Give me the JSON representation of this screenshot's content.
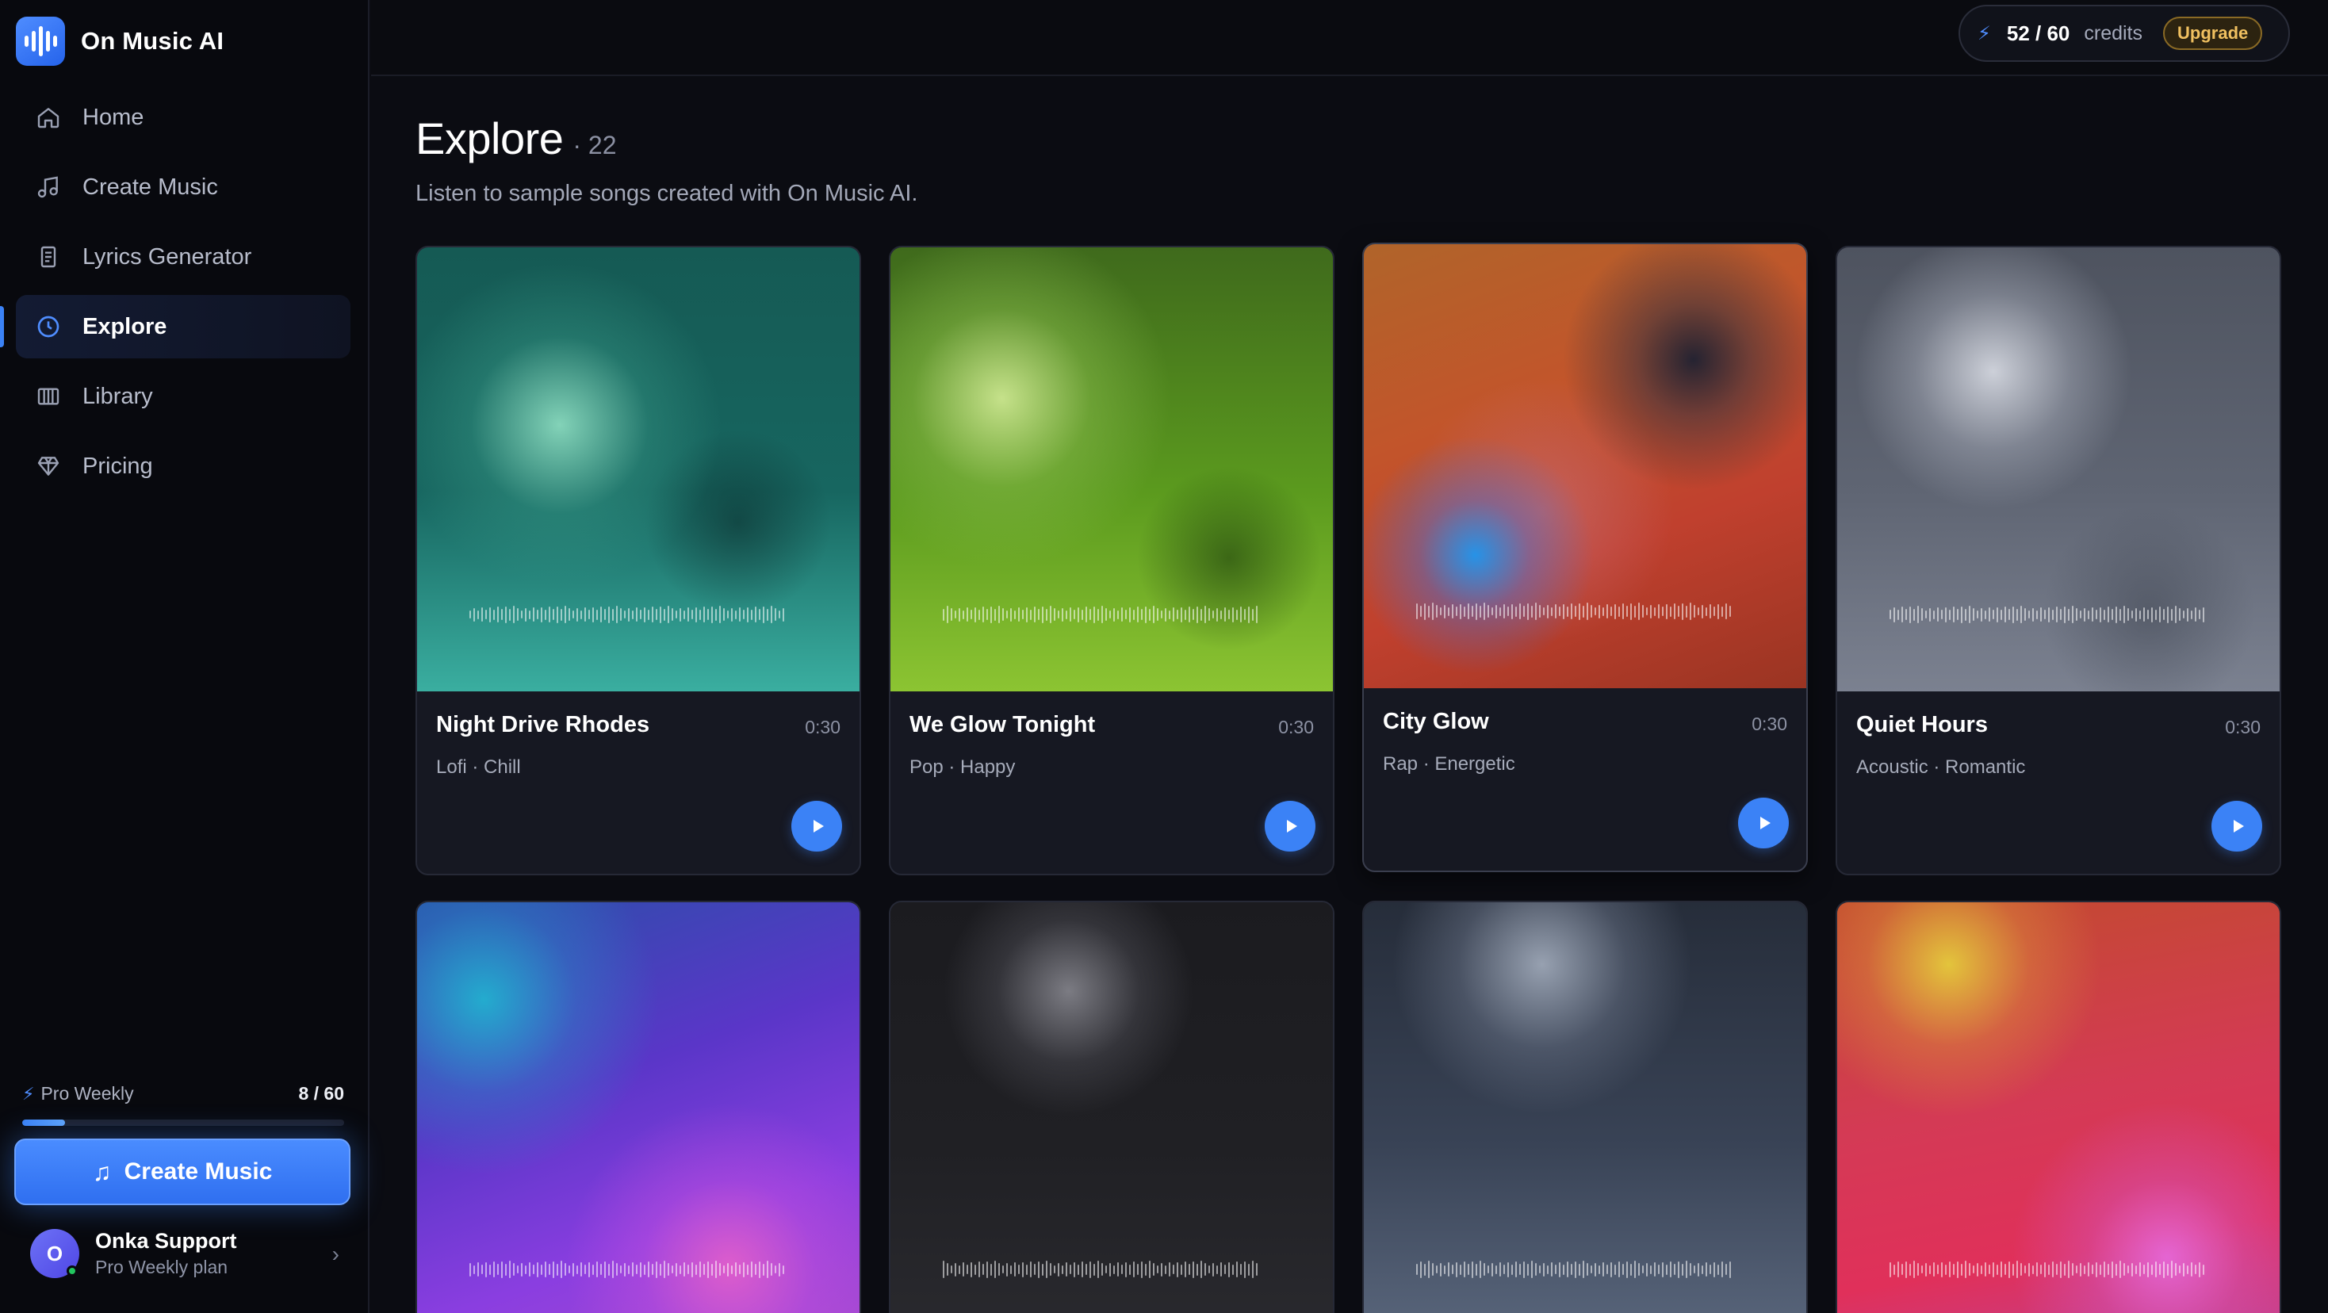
{
  "app": {
    "name": "On Music AI"
  },
  "sidebar": {
    "items": [
      {
        "label": "Home",
        "icon": "home-icon"
      },
      {
        "label": "Create Music",
        "icon": "music-note-icon"
      },
      {
        "label": "Lyrics Generator",
        "icon": "document-icon"
      },
      {
        "label": "Explore",
        "icon": "compass-icon",
        "active": true
      },
      {
        "label": "Library",
        "icon": "library-icon"
      },
      {
        "label": "Pricing",
        "icon": "diamond-icon"
      }
    ],
    "plan": {
      "name": "Pro Weekly",
      "used": "8 / 60",
      "progress": 0.1333
    },
    "create_label": "Create Music",
    "user": {
      "initial": "O",
      "name": "Onka Support",
      "plan": "Pro Weekly plan"
    }
  },
  "topbar": {
    "credits": "52 / 60",
    "credits_unit": "credits",
    "upgrade_label": "Upgrade"
  },
  "main": {
    "title": "Explore",
    "count": "· 22",
    "subtitle": "Listen to sample songs created with On Music AI.",
    "cards": [
      {
        "title": "Night Drive Rhodes",
        "duration": "0:30",
        "genre": "Lofi · Chill"
      },
      {
        "title": "We Glow Tonight",
        "duration": "0:30",
        "genre": "Pop · Happy"
      },
      {
        "title": "City Glow",
        "duration": "0:30",
        "genre": "Rap · Energetic"
      },
      {
        "title": "Quiet Hours",
        "duration": "0:30",
        "genre": "Acoustic · Romantic"
      },
      {
        "title": "",
        "duration": "",
        "genre": ""
      },
      {
        "title": "",
        "duration": "",
        "genre": ""
      },
      {
        "title": "",
        "duration": "",
        "genre": ""
      },
      {
        "title": "",
        "duration": "",
        "genre": ""
      }
    ]
  },
  "colors": {
    "accent": "#3b82f6",
    "upgrade": "#f0c060",
    "background": "#0b0c12"
  }
}
